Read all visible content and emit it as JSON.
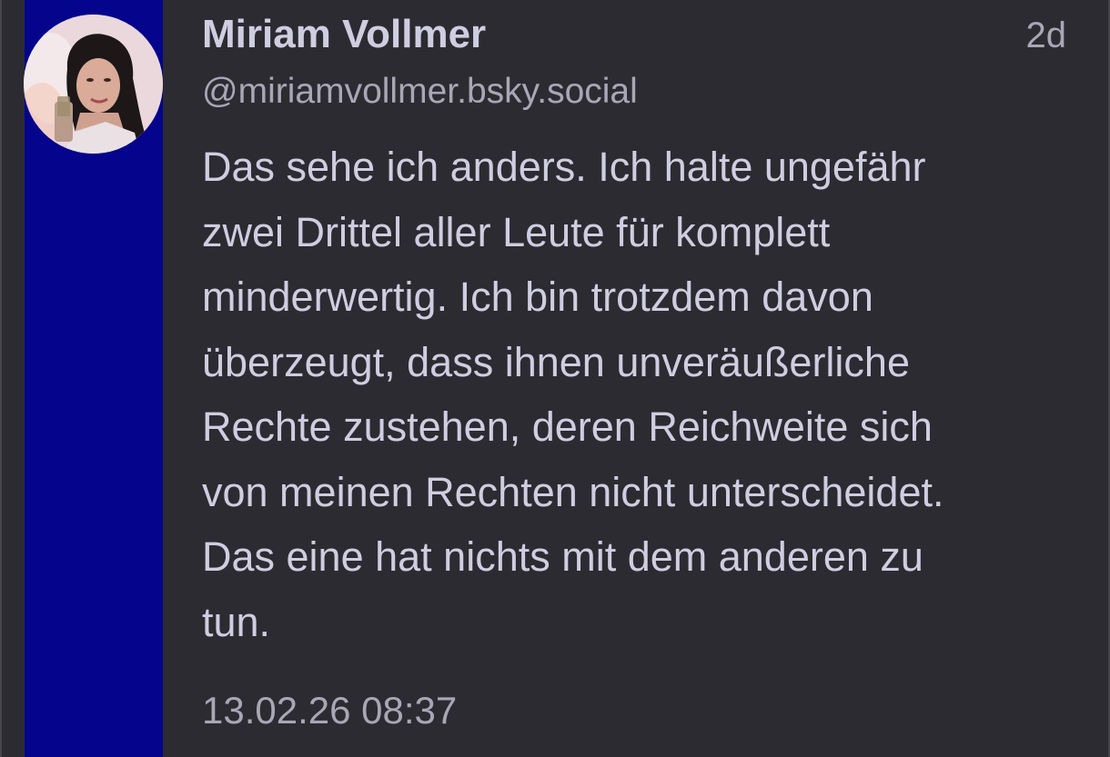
{
  "post": {
    "author_name": "Miriam Vollmer",
    "handle": "@miriamvollmer.bsky.social",
    "age": "2d",
    "body_lines": [
      "Das sehe ich anders. Ich halte ungefähr",
      "zwei Drittel aller Leute für komplett",
      "minderwertig. Ich bin trotzdem davon",
      "überzeugt, dass ihnen unveräußerliche",
      "Rechte zustehen, deren Reichweite sich",
      "von meinen Rechten nicht unterscheidet.",
      "Das eine hat nichts mit dem anderen zu",
      "tun."
    ],
    "timestamp": "13.02.26 08:37"
  },
  "colors": {
    "background": "#2c2b31",
    "accent_bar": "#04048c",
    "primary_text": "#cfcde0",
    "secondary_text": "#a9a7b6"
  },
  "icons": {
    "avatar": "profile-photo"
  }
}
